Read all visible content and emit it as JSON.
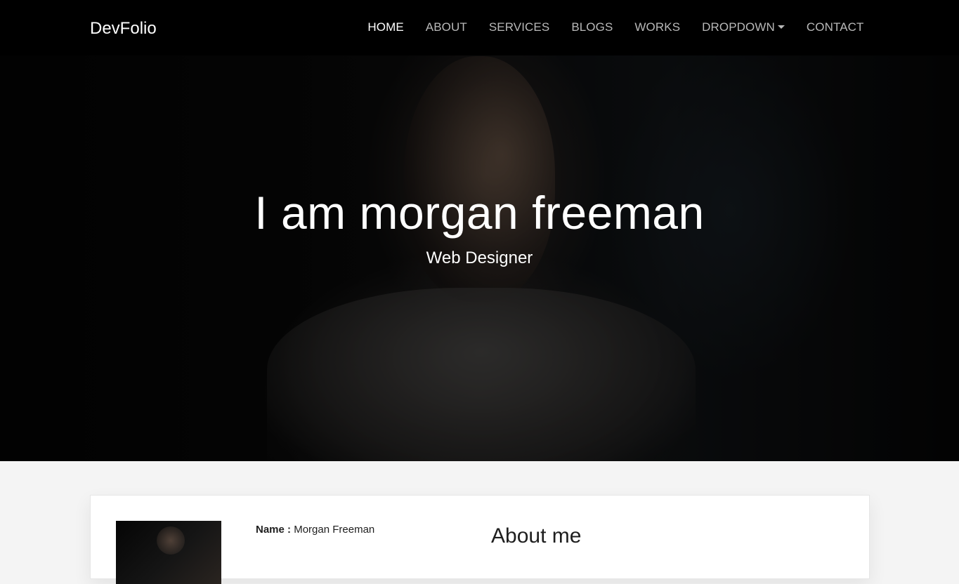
{
  "navbar": {
    "brand": "DevFolio",
    "links": [
      {
        "label": "HOME",
        "active": true
      },
      {
        "label": "ABOUT",
        "active": false
      },
      {
        "label": "SERVICES",
        "active": false
      },
      {
        "label": "BLOGS",
        "active": false
      },
      {
        "label": "WORKS",
        "active": false
      },
      {
        "label": "DROPDOWN",
        "active": false,
        "has_caret": true
      },
      {
        "label": "CONTACT",
        "active": false
      }
    ]
  },
  "hero": {
    "title": "I am morgan freeman",
    "subtitle": "Web Designer"
  },
  "about": {
    "name_label": "Name :",
    "name_value": "Morgan Freeman",
    "title": "About me"
  },
  "colors": {
    "nav_bg": "#000000",
    "nav_active": "#ffffff",
    "nav_inactive": "#b9b9b9",
    "page_bg": "#f4f4f4"
  }
}
